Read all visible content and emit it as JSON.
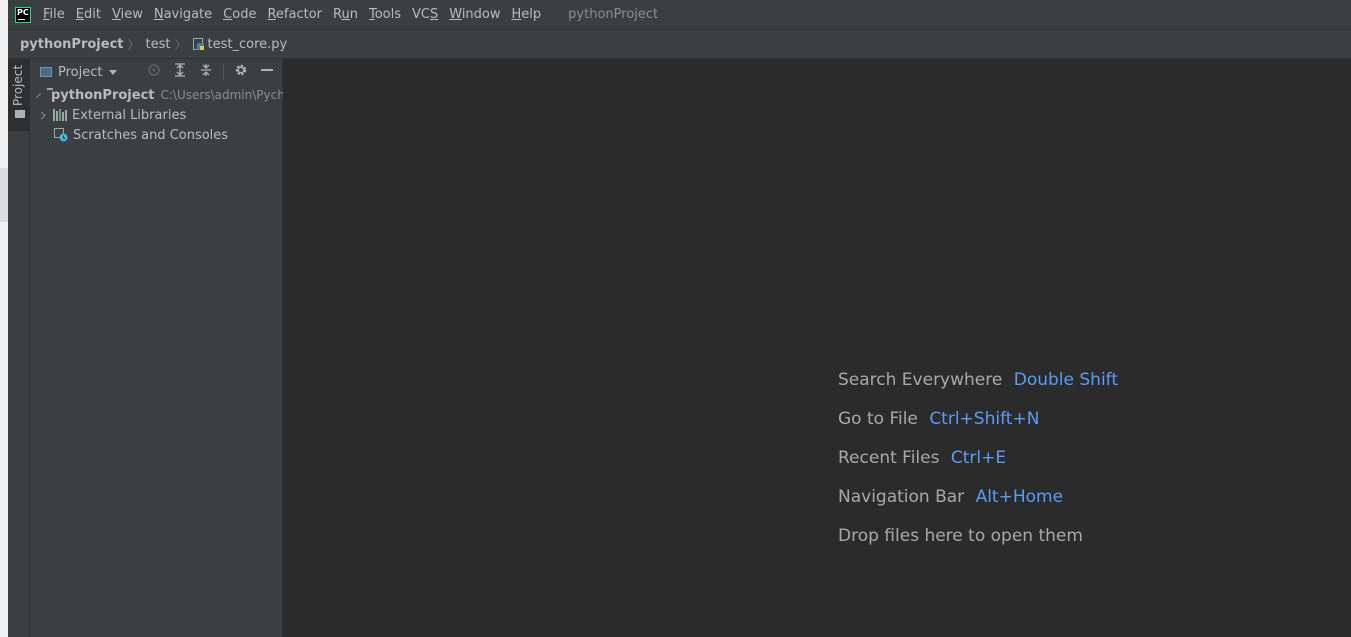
{
  "menubar": {
    "logo_text": "PC",
    "items": [
      "File",
      "Edit",
      "View",
      "Navigate",
      "Code",
      "Refactor",
      "Run",
      "Tools",
      "VCS",
      "Window",
      "Help"
    ],
    "underline": [
      "F",
      "E",
      "V",
      "N",
      "C",
      "R",
      "u",
      "T",
      "S",
      "W",
      "H"
    ],
    "project_title": "pythonProject"
  },
  "breadcrumb": {
    "root": "pythonProject",
    "folder": "test",
    "file": "test_core.py"
  },
  "tool_stripe": {
    "project_tab_label": "Project"
  },
  "project_panel": {
    "view_label": "Project",
    "tree": [
      {
        "label": "pythonProject",
        "path": "C:\\Users\\admin\\PycharmProjects",
        "expandable": true,
        "icon": "folder-icon"
      },
      {
        "label": "External Libraries",
        "expandable": true,
        "icon": "library-icon"
      },
      {
        "label": "Scratches and Consoles",
        "expandable": false,
        "icon": "scratches-icon"
      }
    ]
  },
  "editor": {
    "hints": [
      {
        "text": "Search Everywhere",
        "shortcut": "Double Shift"
      },
      {
        "text": "Go to File",
        "shortcut": "Ctrl+Shift+N"
      },
      {
        "text": "Recent Files",
        "shortcut": "Ctrl+E"
      },
      {
        "text": "Navigation Bar",
        "shortcut": "Alt+Home"
      },
      {
        "text": "Drop files here to open them",
        "shortcut": ""
      }
    ]
  },
  "colors": {
    "background": "#2b2b2b",
    "chrome": "#3c3f41",
    "shortcut": "#589df6",
    "text": "#bbbbbb"
  }
}
